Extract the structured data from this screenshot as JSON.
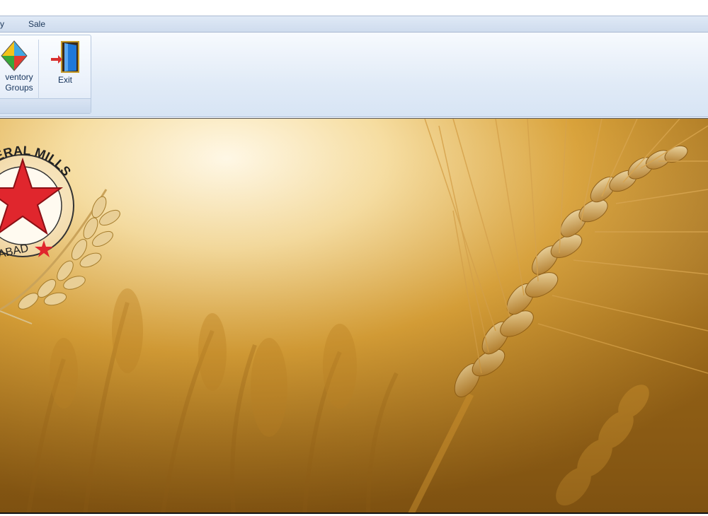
{
  "menu": {
    "items": [
      {
        "label": "y"
      },
      {
        "label": "Sale"
      }
    ]
  },
  "ribbon": {
    "buttons": [
      {
        "label_line1": "ventory",
        "label_line2": "Groups",
        "icon": "inventory-groups-icon"
      },
      {
        "label_line1": "Exit",
        "icon": "exit-door-icon"
      }
    ]
  },
  "logo": {
    "ring_text_top": "& GENERAL MILLS",
    "ring_text_bottom": "ABAD"
  },
  "colors": {
    "menubar": "#cfdcee",
    "ribbon": "#e1ebf7",
    "wheat_gold": "#d9a23a",
    "logo_red": "#e0262d"
  }
}
